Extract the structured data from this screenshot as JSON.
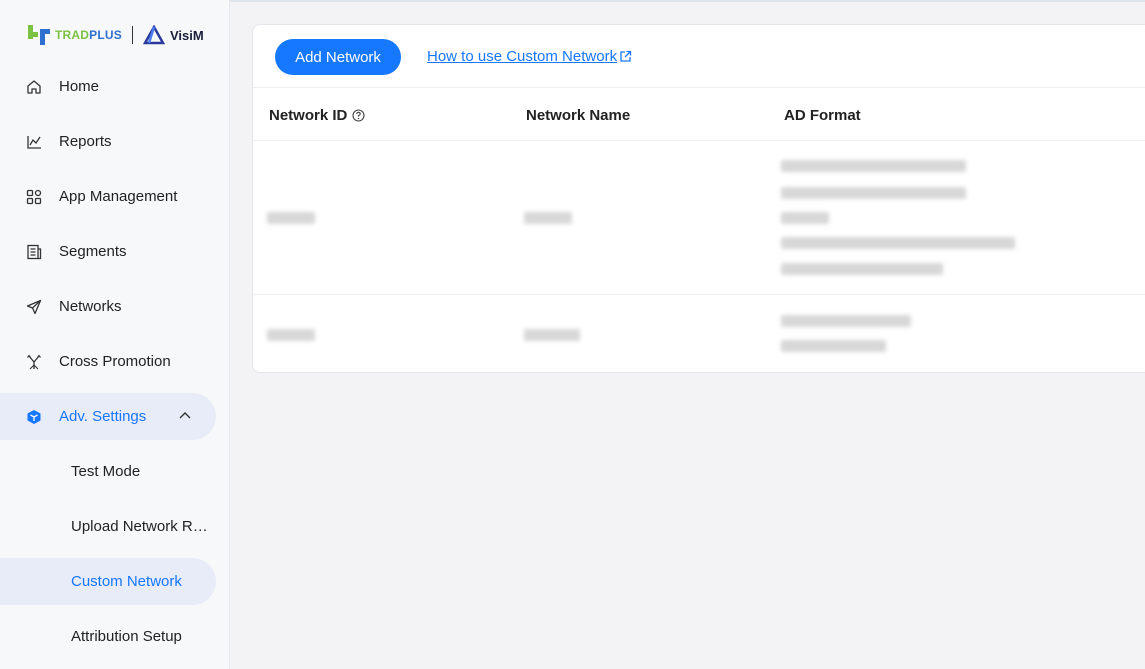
{
  "brand": {
    "tradplus_left": "TRAD",
    "tradplus_right": "PLUS",
    "visim": "VisiM"
  },
  "sidebar": {
    "items": [
      {
        "label": "Home",
        "icon": "home-icon"
      },
      {
        "label": "Reports",
        "icon": "chart-line-icon"
      },
      {
        "label": "App Management",
        "icon": "grid-icon"
      },
      {
        "label": "Segments",
        "icon": "document-list-icon"
      },
      {
        "label": "Networks",
        "icon": "send-icon"
      },
      {
        "label": "Cross Promotion",
        "icon": "split-arrows-icon"
      },
      {
        "label": "Adv. Settings",
        "icon": "cube-icon",
        "expanded": true
      }
    ],
    "sub_items": [
      {
        "label": "Test Mode"
      },
      {
        "label": "Upload Network R…"
      },
      {
        "label": "Custom Network",
        "active": true
      },
      {
        "label": "Attribution Setup"
      }
    ]
  },
  "main": {
    "add_button": "Add Network",
    "help_link": "How to use Custom Network",
    "columns": [
      "Network ID",
      "Network Name",
      "AD Format"
    ]
  },
  "colors": {
    "accent": "#1677ff",
    "active_bg": "#e8ecf8",
    "sidebar_bg": "#f7f8fa",
    "page_bg": "#f3f3f5"
  }
}
